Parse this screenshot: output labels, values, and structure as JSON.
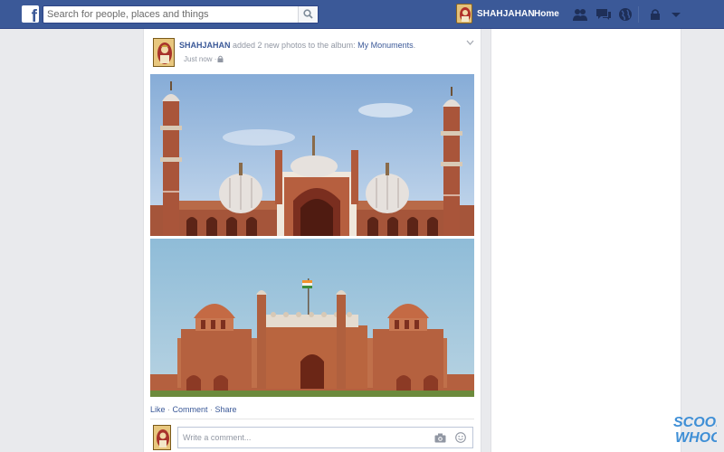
{
  "topbar": {
    "search_placeholder": "Search for people, places and things",
    "user_name": "SHAHJAHAN",
    "home_label": "Home",
    "brand_color": "#3b5998"
  },
  "post": {
    "author": "SHAHJAHAN",
    "action_text": " added 2 new photos to the album: ",
    "album": "My Monuments",
    "album_suffix": ".",
    "time": "Just now ·",
    "photos": [
      "jama-masjid-photo",
      "red-fort-photo"
    ],
    "actions": {
      "like": "Like",
      "sep1": " · ",
      "comment": "Comment",
      "sep2": " · ",
      "share": "Share"
    },
    "comment_placeholder": "Write a comment..."
  },
  "watermark": {
    "line1": "SCOOP",
    "line2": "WHOOP"
  }
}
